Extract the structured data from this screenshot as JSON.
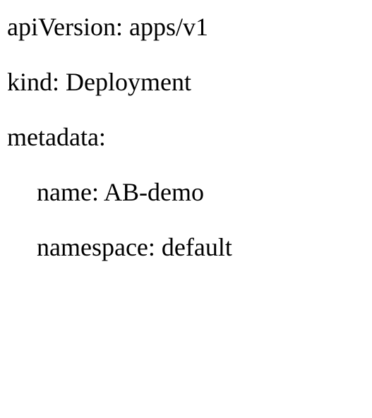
{
  "yaml": {
    "line1": "apiVersion: apps/v1",
    "line2": "kind: Deployment",
    "line3": "metadata:",
    "line4": "name: AB-demo",
    "line5": "namespace: default"
  }
}
